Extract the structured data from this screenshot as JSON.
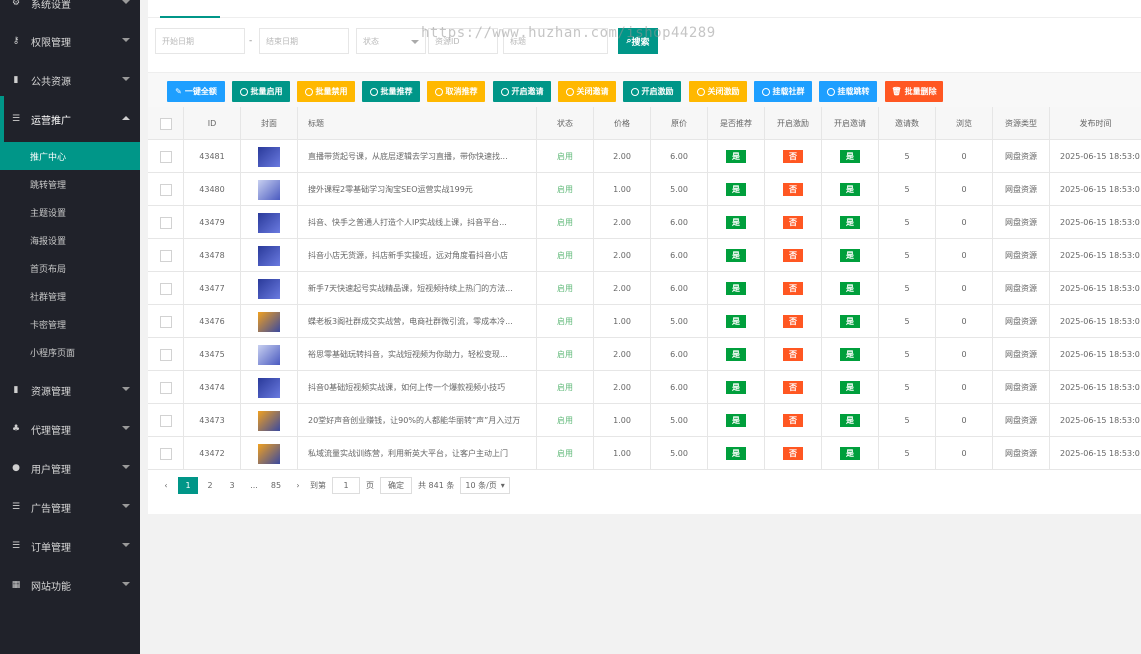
{
  "sidebar": {
    "items": [
      {
        "label": "系统设置",
        "icon": "gear-icon"
      },
      {
        "label": "权限管理",
        "icon": "key-icon"
      },
      {
        "label": "公共资源",
        "icon": "book-icon"
      },
      {
        "label": "运营推广",
        "icon": "list-icon"
      },
      {
        "label": "资源管理",
        "icon": "book-icon"
      },
      {
        "label": "代理管理",
        "icon": "users-icon"
      },
      {
        "label": "用户管理",
        "icon": "user-icon"
      },
      {
        "label": "广告管理",
        "icon": "list-icon"
      },
      {
        "label": "订单管理",
        "icon": "list-icon"
      },
      {
        "label": "网站功能",
        "icon": "grid-icon"
      }
    ],
    "sub_items": [
      "推广中心",
      "跳转管理",
      "主题设置",
      "海报设置",
      "首页布局",
      "社群管理",
      "卡密管理",
      "小程序页面"
    ]
  },
  "filters": {
    "start_date": "开始日期",
    "end_date": "结束日期",
    "dash": "-",
    "status": "状态",
    "resource_id": "资源ID",
    "title": "标题",
    "search": "搜索"
  },
  "toolbar": [
    {
      "label": "一键全额",
      "color": "#1e9fff",
      "icon": "pencil-icon"
    },
    {
      "label": "批量启用",
      "color": "#009688",
      "icon": "play-icon"
    },
    {
      "label": "批量禁用",
      "color": "#ffb800",
      "icon": "ban-icon"
    },
    {
      "label": "批量推荐",
      "color": "#009688",
      "icon": "play-icon"
    },
    {
      "label": "取消推荐",
      "color": "#ffb800",
      "icon": "ban-icon"
    },
    {
      "label": "开启邀请",
      "color": "#009688",
      "icon": "play-icon"
    },
    {
      "label": "关闭邀请",
      "color": "#ffb800",
      "icon": "ban-icon"
    },
    {
      "label": "开启激励",
      "color": "#009688",
      "icon": "play-icon"
    },
    {
      "label": "关闭激励",
      "color": "#ffb800",
      "icon": "ban-icon"
    },
    {
      "label": "挂载社群",
      "color": "#1e9fff",
      "icon": "play-icon"
    },
    {
      "label": "挂载跳转",
      "color": "#1e9fff",
      "icon": "play-icon"
    },
    {
      "label": "批量删除",
      "color": "#ff5722",
      "icon": "trash-icon"
    }
  ],
  "table": {
    "columns": [
      "ID",
      "封面",
      "标题",
      "状态",
      "价格",
      "原价",
      "是否推荐",
      "开启激励",
      "开启邀请",
      "邀请数",
      "浏览",
      "资源类型",
      "发布时间"
    ],
    "rows": [
      {
        "id": "43481",
        "title": "直播带货起号课，从底层逻辑去学习直播，带你快速找...",
        "status": "启用",
        "price": "2.00",
        "orig": "6.00",
        "rec": "是",
        "inc": "否",
        "inv": "是",
        "invites": "5",
        "views": "0",
        "type": "网盘资源",
        "time": "2025-06-15 18:53:0",
        "thumb": "dark"
      },
      {
        "id": "43480",
        "title": "搜外课程2零基础学习淘宝SEO运营实战199元",
        "status": "启用",
        "price": "1.00",
        "orig": "5.00",
        "rec": "是",
        "inc": "否",
        "inv": "是",
        "invites": "5",
        "views": "0",
        "type": "网盘资源",
        "time": "2025-06-15 18:53:0",
        "thumb": "light"
      },
      {
        "id": "43479",
        "title": "抖音、快手之普通人打造个人IP实战线上课，抖音平台...",
        "status": "启用",
        "price": "2.00",
        "orig": "6.00",
        "rec": "是",
        "inc": "否",
        "inv": "是",
        "invites": "5",
        "views": "0",
        "type": "网盘资源",
        "time": "2025-06-15 18:53:0",
        "thumb": "dark"
      },
      {
        "id": "43478",
        "title": "抖音小店无货源，抖店新手实操班，远对角度看抖音小店",
        "status": "启用",
        "price": "2.00",
        "orig": "6.00",
        "rec": "是",
        "inc": "否",
        "inv": "是",
        "invites": "5",
        "views": "0",
        "type": "网盘资源",
        "time": "2025-06-15 18:53:0",
        "thumb": "dark"
      },
      {
        "id": "43477",
        "title": "新手7天快速起号实战精品课，短视频持续上热门的方法...",
        "status": "启用",
        "price": "2.00",
        "orig": "6.00",
        "rec": "是",
        "inc": "否",
        "inv": "是",
        "invites": "5",
        "views": "0",
        "type": "网盘资源",
        "time": "2025-06-15 18:53:0",
        "thumb": "dark"
      },
      {
        "id": "43476",
        "title": "蝶老板3阁社群成交实战营，电商社群微引流，零成本冷...",
        "status": "启用",
        "price": "1.00",
        "orig": "5.00",
        "rec": "是",
        "inc": "否",
        "inv": "是",
        "invites": "5",
        "views": "0",
        "type": "网盘资源",
        "time": "2025-06-15 18:53:0",
        "thumb": "alt"
      },
      {
        "id": "43475",
        "title": "裕思零基础玩转抖音，实战短视频为你助力，轻松变现...",
        "status": "启用",
        "price": "2.00",
        "orig": "6.00",
        "rec": "是",
        "inc": "否",
        "inv": "是",
        "invites": "5",
        "views": "0",
        "type": "网盘资源",
        "time": "2025-06-15 18:53:0",
        "thumb": "light"
      },
      {
        "id": "43474",
        "title": "抖音0基础短视频实战课，如何上传一个爆款视频小技巧",
        "status": "启用",
        "price": "2.00",
        "orig": "6.00",
        "rec": "是",
        "inc": "否",
        "inv": "是",
        "invites": "5",
        "views": "0",
        "type": "网盘资源",
        "time": "2025-06-15 18:53:0",
        "thumb": "dark"
      },
      {
        "id": "43473",
        "title": "20堂好声音创业赚钱，让90%的人都能华丽转“声”月入过万",
        "status": "启用",
        "price": "1.00",
        "orig": "5.00",
        "rec": "是",
        "inc": "否",
        "inv": "是",
        "invites": "5",
        "views": "0",
        "type": "网盘资源",
        "time": "2025-06-15 18:53:0",
        "thumb": "alt"
      },
      {
        "id": "43472",
        "title": "私域流量实战训练营，利用新英大平台，让客户主动上门",
        "status": "启用",
        "price": "1.00",
        "orig": "5.00",
        "rec": "是",
        "inc": "否",
        "inv": "是",
        "invites": "5",
        "views": "0",
        "type": "网盘资源",
        "time": "2025-06-15 18:53:0",
        "thumb": "alt"
      }
    ]
  },
  "pager": {
    "pages": [
      "1",
      "2",
      "3",
      "...",
      "85"
    ],
    "goto_label": "到第",
    "goto_value": "1",
    "page_unit": "页",
    "confirm": "确定",
    "total": "共 841 条",
    "per_page": "10 条/页"
  },
  "watermark": "https://www.huzhan.com/ishop44289"
}
